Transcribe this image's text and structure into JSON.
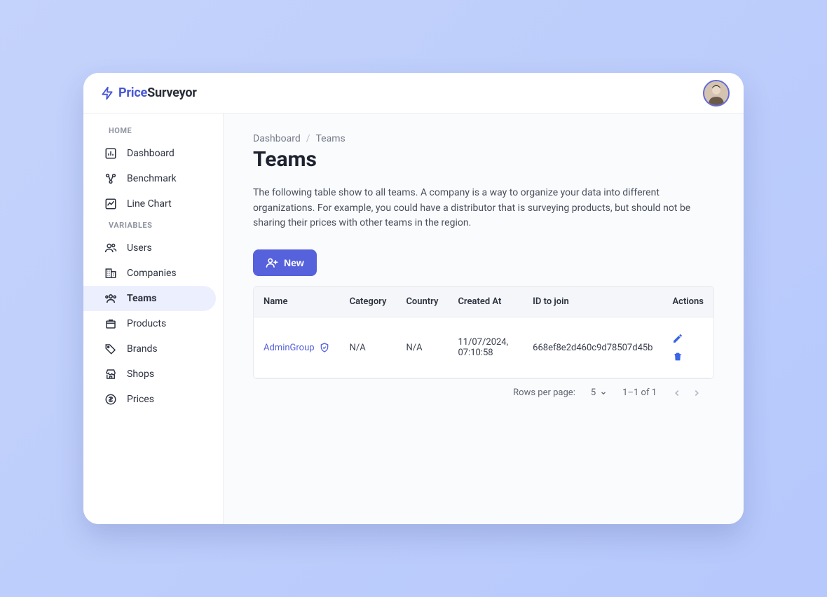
{
  "brand": {
    "prefix": "Price",
    "suffix": "Surveyor"
  },
  "sidebar": {
    "section1_label": "HOME",
    "section2_label": "VARIABLES",
    "items_home": [
      {
        "label": "Dashboard"
      },
      {
        "label": "Benchmark"
      },
      {
        "label": "Line Chart"
      }
    ],
    "items_vars": [
      {
        "label": "Users"
      },
      {
        "label": "Companies"
      },
      {
        "label": "Teams"
      },
      {
        "label": "Products"
      },
      {
        "label": "Brands"
      },
      {
        "label": "Shops"
      },
      {
        "label": "Prices"
      }
    ]
  },
  "breadcrumb": {
    "root": "Dashboard",
    "current": "Teams"
  },
  "page": {
    "title": "Teams",
    "description": "The following table show to all teams. A company is a way to organize your data into different organizations. For example, you could have a distributor that is surveying products, but should not be sharing their prices with other teams in the region.",
    "new_button": "New"
  },
  "table": {
    "headers": {
      "name": "Name",
      "category": "Category",
      "country": "Country",
      "created_at": "Created At",
      "id_to_join": "ID to join",
      "actions": "Actions"
    },
    "rows": [
      {
        "name": "AdminGroup",
        "category": "N/A",
        "country": "N/A",
        "created_at": "11/07/2024, 07:10:58",
        "id_to_join": "668ef8e2d460c9d78507d45b"
      }
    ]
  },
  "pagination": {
    "rows_label": "Rows per page:",
    "rows_value": "5",
    "range": "1–1 of 1"
  }
}
